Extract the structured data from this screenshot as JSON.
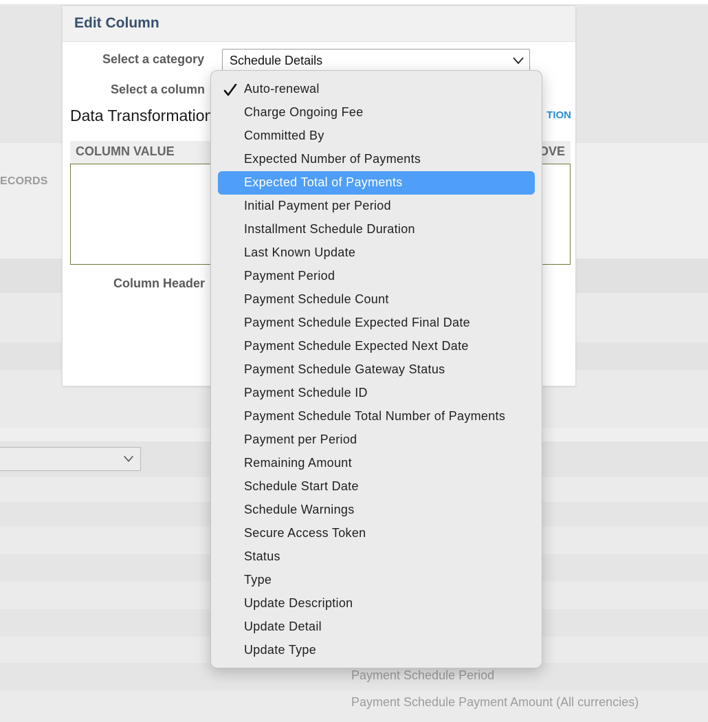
{
  "background": {
    "records_label": "ECORDS",
    "footer_items": [
      "Payment Schedule Period",
      "Payment Schedule Payment Amount (All currencies)"
    ]
  },
  "modal": {
    "title": "Edit Column",
    "category_label": "Select a category",
    "category_value": "Schedule Details",
    "column_label": "Select a column",
    "data_transformation_title": "Data Transformation",
    "add_transformation_link": "TION",
    "table_headers": {
      "column_value": "COLUMN VALUE",
      "remove": "OVE"
    },
    "column_header_label": "Column Header"
  },
  "dropdown": {
    "selected_index": 0,
    "highlighted_index": 4,
    "options": [
      "Auto-renewal",
      "Charge Ongoing Fee",
      "Committed By",
      "Expected Number of Payments",
      "Expected Total of Payments",
      "Initial Payment per Period",
      "Installment Schedule Duration",
      "Last Known Update",
      "Payment Period",
      "Payment Schedule Count",
      "Payment Schedule Expected Final Date",
      "Payment Schedule Expected Next Date",
      "Payment Schedule Gateway Status",
      "Payment Schedule ID",
      "Payment Schedule Total Number of Payments",
      "Payment per Period",
      "Remaining Amount",
      "Schedule Start Date",
      "Schedule Warnings",
      "Secure Access Token",
      "Status",
      "Type",
      "Update Description",
      "Update Detail",
      "Update Type"
    ]
  },
  "colors": {
    "highlight": "#4f9ef7",
    "title": "#37506b",
    "link": "#2a8fd6"
  }
}
